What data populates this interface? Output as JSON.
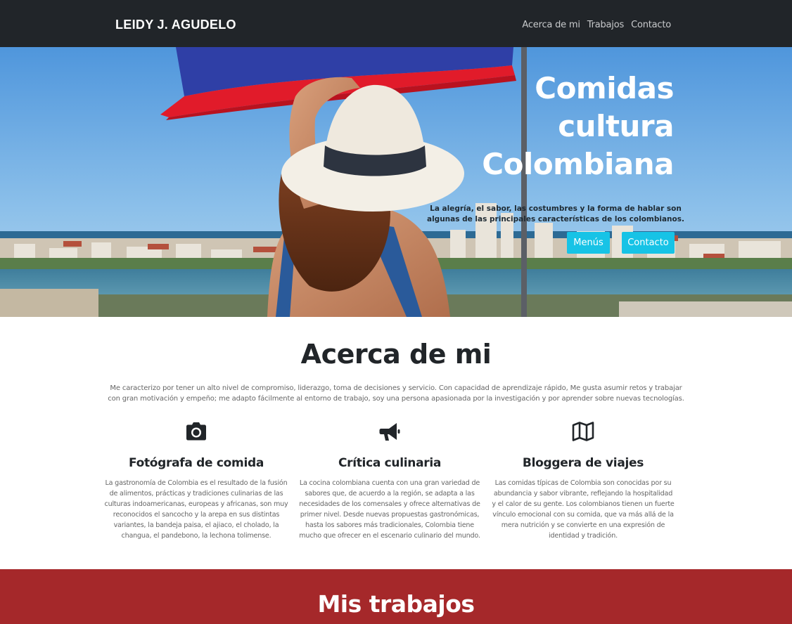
{
  "navbar": {
    "brand": "LEIDY J. AGUDELO",
    "links": [
      "Acerca de mi",
      "Trabajos",
      "Contacto"
    ]
  },
  "hero": {
    "title_lines": [
      "Comidas",
      "cultura",
      "Colombiana"
    ],
    "subtitle": "La alegría, el sabor, las costumbres y la forma de hablar son algunas de las principales características de los colombianos.",
    "buttons": [
      "Menús",
      "Contacto"
    ]
  },
  "about": {
    "title": "Acerca de mi",
    "text": "Me caracterizo por tener un alto nivel de compromiso, liderazgo, toma de decisiones y servicio. Con capacidad de aprendizaje rápido, Me gusta asumir retos y trabajar con gran motivación y empeño; me adapto fácilmente al entorno de trabajo, soy una persona apasionada por la investigación y por aprender sobre nuevas tecnologías.",
    "features": [
      {
        "icon": "camera-icon",
        "title": "Fotógrafa de comida",
        "text": "La gastronomía de Colombia es el resultado de la fusión de alimentos, prácticas y tradiciones culinarias de las culturas indoamericanas, europeas y africanas, son muy reconocidos el sancocho y la arepa en sus distintas variantes, la bandeja paisa, el ajiaco, el cholado, la changua, el pandebono, la lechona tolimense."
      },
      {
        "icon": "megaphone-icon",
        "title": "Crítica culinaria",
        "text": "La cocina colombiana cuenta con una gran variedad de sabores que, de acuerdo a la región, se adapta a las necesidades de los comensales y ofrece alternativas de primer nivel. Desde nuevas propuestas gastronómicas, hasta los sabores más tradicionales, Colombia tiene mucho que ofrecer en el escenario culinario del mundo."
      },
      {
        "icon": "map-icon",
        "title": "Bloggera de viajes",
        "text": "Las comidas típicas de Colombia son conocidas por su abundancia y sabor vibrante, reflejando la hospitalidad y el calor de su gente. Los colombianos tienen un fuerte vínculo emocional con su comida, que va más allá de la mera nutrición y se convierte en una expresión de identidad y tradición."
      }
    ]
  },
  "works": {
    "title": "Mis trabajos"
  },
  "colors": {
    "navbar_bg": "#212529",
    "accent_button": "#17c3e6",
    "works_bg": "#a5282a",
    "heading": "#212529"
  }
}
